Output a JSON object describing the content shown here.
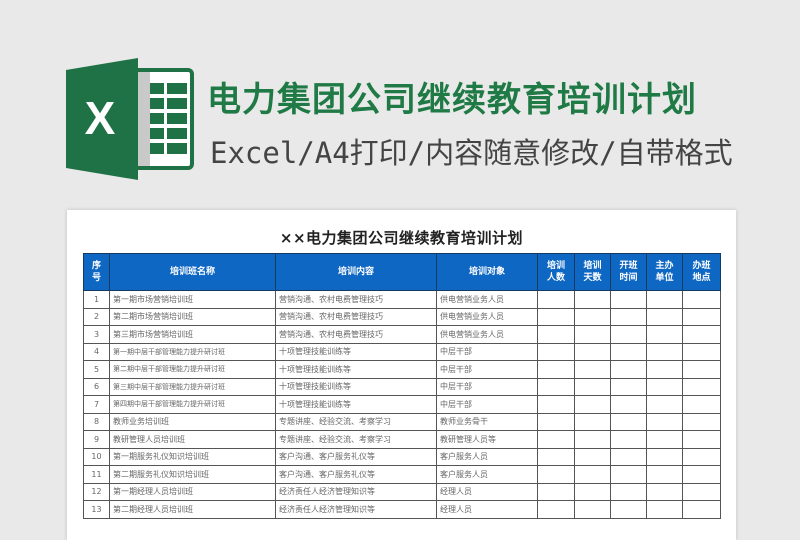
{
  "banner": {
    "icon": "excel-icon",
    "icon_letter": "X",
    "title": "电力集团公司继续教育培训计划",
    "subtitle": "Excel/A4打印/内容随意修改/自带格式",
    "colors": {
      "excel_green": "#1f7246",
      "title_green": "#1f7a45",
      "header_blue": "#0f67c4"
    }
  },
  "sheet": {
    "title": "××电力集团公司继续教育培训计划",
    "columns": [
      "序号",
      "培训班名称",
      "培训内容",
      "培训对象",
      "培训人数",
      "培训天数",
      "开班时间",
      "主办单位",
      "办班地点"
    ],
    "rows": [
      [
        "1",
        "第一期市场营销培训班",
        "营销沟通、农村电费管理技巧",
        "供电营销业务人员",
        "",
        "",
        "",
        "",
        ""
      ],
      [
        "2",
        "第二期市场营销培训班",
        "营销沟通、农村电费管理技巧",
        "供电营销业务人员",
        "",
        "",
        "",
        "",
        ""
      ],
      [
        "3",
        "第三期市场营销培训班",
        "营销沟通、农村电费管理技巧",
        "供电营销业务人员",
        "",
        "",
        "",
        "",
        ""
      ],
      [
        "4",
        "第一期中层干部管理能力提升研讨班",
        "十项管理技能训练等",
        "中层干部",
        "",
        "",
        "",
        "",
        ""
      ],
      [
        "5",
        "第二期中层干部管理能力提升研讨班",
        "十项管理技能训练等",
        "中层干部",
        "",
        "",
        "",
        "",
        ""
      ],
      [
        "6",
        "第三期中层干部管理能力提升研讨班",
        "十项管理技能训练等",
        "中层干部",
        "",
        "",
        "",
        "",
        ""
      ],
      [
        "7",
        "第四期中层干部管理能力提升研讨班",
        "十项管理技能训练等",
        "中层干部",
        "",
        "",
        "",
        "",
        ""
      ],
      [
        "8",
        "教师业务培训班",
        "专题讲座、经验交流、考察学习",
        "教师业务骨干",
        "",
        "",
        "",
        "",
        ""
      ],
      [
        "9",
        "教研管理人员培训班",
        "专题讲座、经验交流、考察学习",
        "教研管理人员等",
        "",
        "",
        "",
        "",
        ""
      ],
      [
        "10",
        "第一期服务礼仪知识培训班",
        "客户沟通、客户服务礼仪等",
        "客户服务人员",
        "",
        "",
        "",
        "",
        ""
      ],
      [
        "11",
        "第二期服务礼仪知识培训班",
        "客户沟通、客户服务礼仪等",
        "客户服务人员",
        "",
        "",
        "",
        "",
        ""
      ],
      [
        "12",
        "第一期经理人员培训班",
        "经济责任人经济管理知识等",
        "经理人员",
        "",
        "",
        "",
        "",
        ""
      ],
      [
        "13",
        "第二期经理人员培训班",
        "经济责任人经济管理知识等",
        "经理人员",
        "",
        "",
        "",
        "",
        ""
      ]
    ]
  }
}
